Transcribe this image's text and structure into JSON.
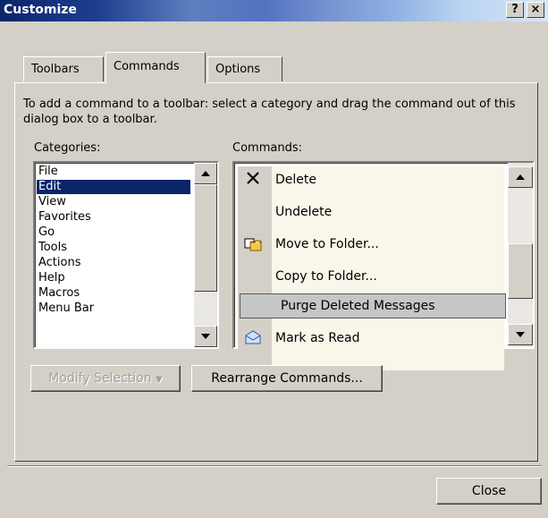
{
  "window": {
    "title": "Customize",
    "help_button": "?",
    "close_button": "×"
  },
  "tabs": [
    {
      "label": "Toolbars"
    },
    {
      "label": "Commands"
    },
    {
      "label": "Options"
    }
  ],
  "instructions": "To add a command to a toolbar: select a category and drag the command out of this dialog box to a toolbar.",
  "categories": {
    "label": "Categories:",
    "items": [
      "File",
      "Edit",
      "View",
      "Favorites",
      "Go",
      "Tools",
      "Actions",
      "Help",
      "Macros",
      "Menu Bar"
    ],
    "selected": "Edit"
  },
  "commands": {
    "label": "Commands:",
    "items": [
      {
        "label": "Delete",
        "icon": "delete-x-icon"
      },
      {
        "label": "Undelete",
        "icon": ""
      },
      {
        "label": "Move to Folder...",
        "icon": "move-to-folder-icon"
      },
      {
        "label": "Copy to Folder...",
        "icon": ""
      },
      {
        "label": "Purge Deleted Messages",
        "icon": ""
      },
      {
        "label": "Mark as Read",
        "icon": "mark-as-read-icon"
      }
    ],
    "selected": "Purge Deleted Messages"
  },
  "buttons": {
    "modify_selection": "Modify Selection",
    "rearrange_commands": "Rearrange Commands...",
    "close": "Close"
  }
}
